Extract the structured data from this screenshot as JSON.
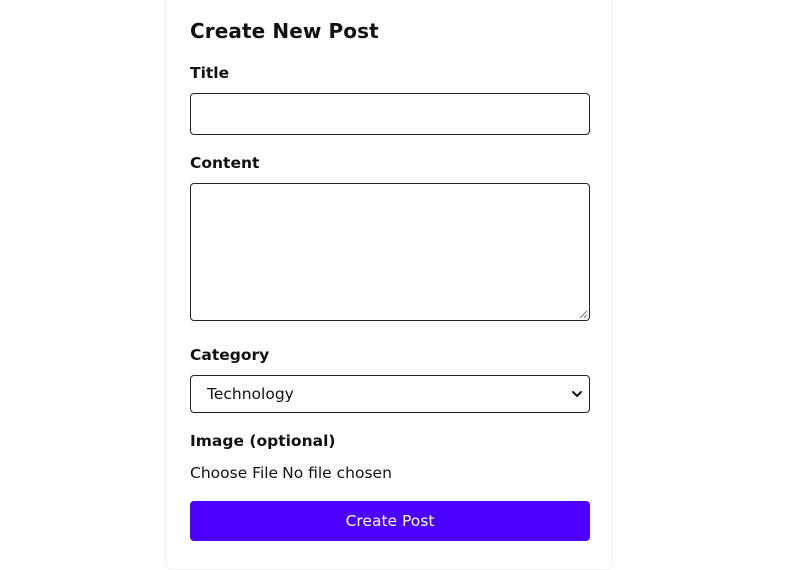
{
  "form": {
    "heading": "Create New Post",
    "title_label": "Title",
    "title_value": "",
    "content_label": "Content",
    "content_value": "",
    "category_label": "Category",
    "category_selected": "Technology",
    "image_label": "Image (optional)",
    "file_button_label": "Choose File",
    "file_status": "No file chosen",
    "submit_label": "Create Post"
  },
  "colors": {
    "primary": "#4b00ff",
    "border": "#222222",
    "text": "#111111"
  }
}
